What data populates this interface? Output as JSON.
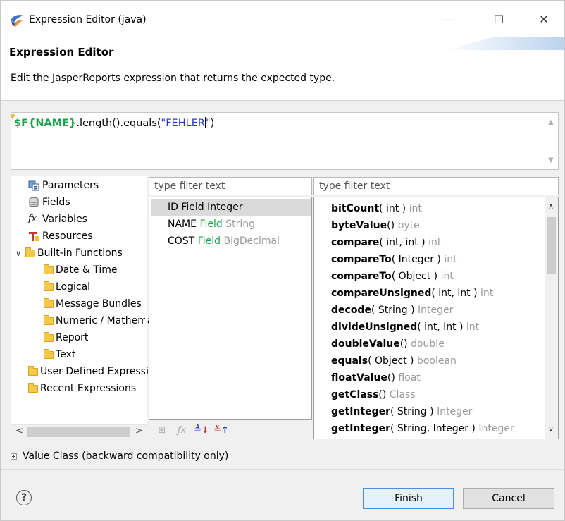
{
  "window": {
    "title": "Expression Editor (java)",
    "min_symbol": "—",
    "max_symbol": "☐",
    "close_symbol": "✕"
  },
  "header": {
    "title": "Expression Editor",
    "description": "Edit the JasperReports expression that returns the expected type."
  },
  "expression": {
    "field_token": "$F{NAME}",
    "method_text": ".length().equals(",
    "string_token": "\"FEHLER",
    "string_close": "\"",
    "tail": ")"
  },
  "tree": {
    "items": [
      {
        "label": "Parameters",
        "icon": "parameters-icon"
      },
      {
        "label": "Fields",
        "icon": "fields-icon"
      },
      {
        "label": "Variables",
        "icon": "variables-icon"
      },
      {
        "label": "Resources",
        "icon": "resources-icon"
      },
      {
        "label": "Built-in Functions",
        "icon": "folder-icon"
      },
      {
        "label": "Date & Time",
        "icon": "folder-icon"
      },
      {
        "label": "Logical",
        "icon": "folder-icon"
      },
      {
        "label": "Message Bundles",
        "icon": "folder-icon"
      },
      {
        "label": "Numeric / Mathematical",
        "icon": "folder-icon"
      },
      {
        "label": "Report",
        "icon": "folder-icon"
      },
      {
        "label": "Text",
        "icon": "folder-icon"
      },
      {
        "label": "User Defined Expressions",
        "icon": "folder-icon"
      },
      {
        "label": "Recent Expressions",
        "icon": "folder-icon"
      }
    ],
    "scroll_left": "<",
    "scroll_right": ">"
  },
  "fields_filter": {
    "placeholder": "type filter text"
  },
  "fields": [
    {
      "name": "ID",
      "kind": "Field",
      "type": "Integer"
    },
    {
      "name": "NAME",
      "kind": "Field",
      "type": "String"
    },
    {
      "name": "COST",
      "kind": "Field",
      "type": "BigDecimal"
    }
  ],
  "methods_filter": {
    "placeholder": "type filter text"
  },
  "methods": [
    {
      "name": "bitCount",
      "args": "( int )",
      "ret": "int"
    },
    {
      "name": "byteValue",
      "args": "()",
      "ret": "byte"
    },
    {
      "name": "compare",
      "args": "( int, int )",
      "ret": "int"
    },
    {
      "name": "compareTo",
      "args": "( Integer )",
      "ret": "int"
    },
    {
      "name": "compareTo",
      "args": "( Object )",
      "ret": "int"
    },
    {
      "name": "compareUnsigned",
      "args": "( int, int )",
      "ret": "int"
    },
    {
      "name": "decode",
      "args": "( String )",
      "ret": "Integer"
    },
    {
      "name": "divideUnsigned",
      "args": "( int, int )",
      "ret": "int"
    },
    {
      "name": "doubleValue",
      "args": "()",
      "ret": "double"
    },
    {
      "name": "equals",
      "args": "( Object )",
      "ret": "boolean"
    },
    {
      "name": "floatValue",
      "args": "()",
      "ret": "float"
    },
    {
      "name": "getClass",
      "args": "()",
      "ret": "Class"
    },
    {
      "name": "getInteger",
      "args": "( String )",
      "ret": "Integer"
    },
    {
      "name": "getInteger",
      "args": "( String, Integer )",
      "ret": "Integer"
    }
  ],
  "value_class": {
    "label": "Value Class (backward compatibility only)"
  },
  "buttons": {
    "finish": "Finish",
    "cancel": "Cancel",
    "help": "?"
  }
}
